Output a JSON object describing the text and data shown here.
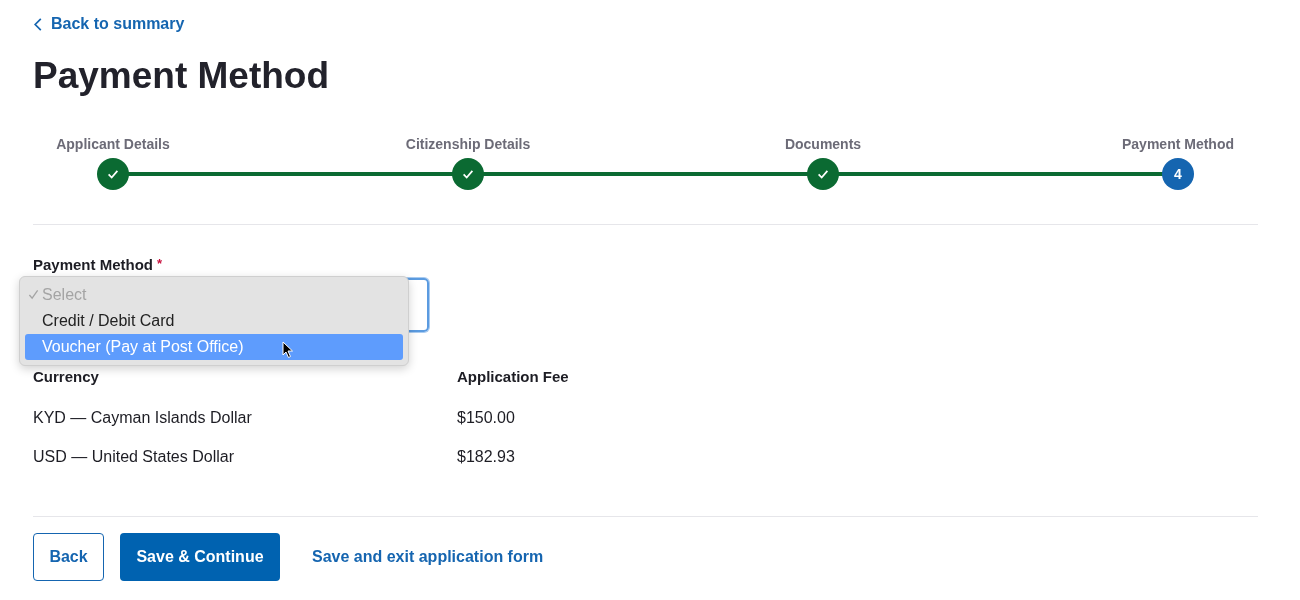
{
  "back_link": "Back to summary",
  "title": "Payment Method",
  "steps": [
    {
      "label": "Applicant Details",
      "kind": "complete"
    },
    {
      "label": "Citizenship Details",
      "kind": "complete"
    },
    {
      "label": "Documents",
      "kind": "complete"
    },
    {
      "label": "Payment Method",
      "kind": "current",
      "number": "4"
    }
  ],
  "payment_field": {
    "label": "Payment Method",
    "required": true,
    "required_mark": "*",
    "focused": true,
    "options": [
      {
        "label": "Select",
        "checked": true,
        "disabled": true,
        "highlighted": false
      },
      {
        "label": "Credit / Debit Card",
        "checked": false,
        "disabled": false,
        "highlighted": false
      },
      {
        "label": "Voucher (Pay at Post Office)",
        "checked": false,
        "disabled": false,
        "highlighted": true
      }
    ]
  },
  "table": {
    "columns": [
      "Currency",
      "Application Fee"
    ],
    "rows": [
      [
        "KYD — Cayman Islands Dollar",
        "$150.00"
      ],
      [
        "USD — United States Dollar",
        "$182.93"
      ]
    ]
  },
  "buttons": {
    "back": "Back",
    "save_continue": "Save & Continue",
    "save_exit": "Save and exit application form"
  }
}
